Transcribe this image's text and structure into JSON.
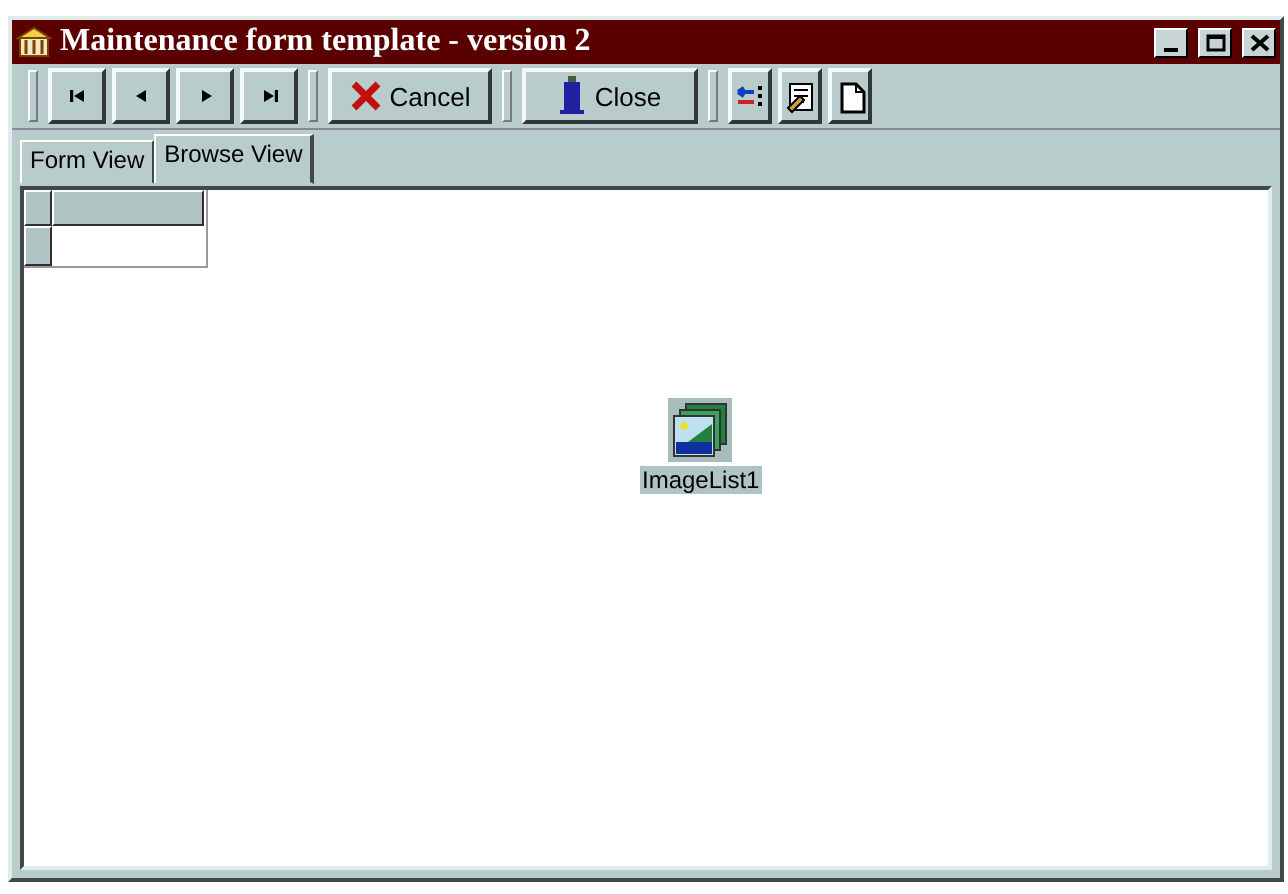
{
  "window": {
    "title": "Maintenance form template - version 2"
  },
  "toolbar": {
    "nav_buttons": [
      {
        "kind": "first"
      },
      {
        "kind": "prev"
      },
      {
        "kind": "next"
      },
      {
        "kind": "last"
      }
    ],
    "cancel": {
      "label": "Cancel"
    },
    "close": {
      "label": "Close"
    },
    "tool_buttons": [
      {
        "kind": "fields"
      },
      {
        "kind": "edit"
      },
      {
        "kind": "new"
      }
    ]
  },
  "tabs": [
    {
      "label": "Form View",
      "selected": false
    },
    {
      "label": "Browse View",
      "selected": true
    }
  ],
  "component": {
    "label": "ImageList1",
    "selected": true
  }
}
